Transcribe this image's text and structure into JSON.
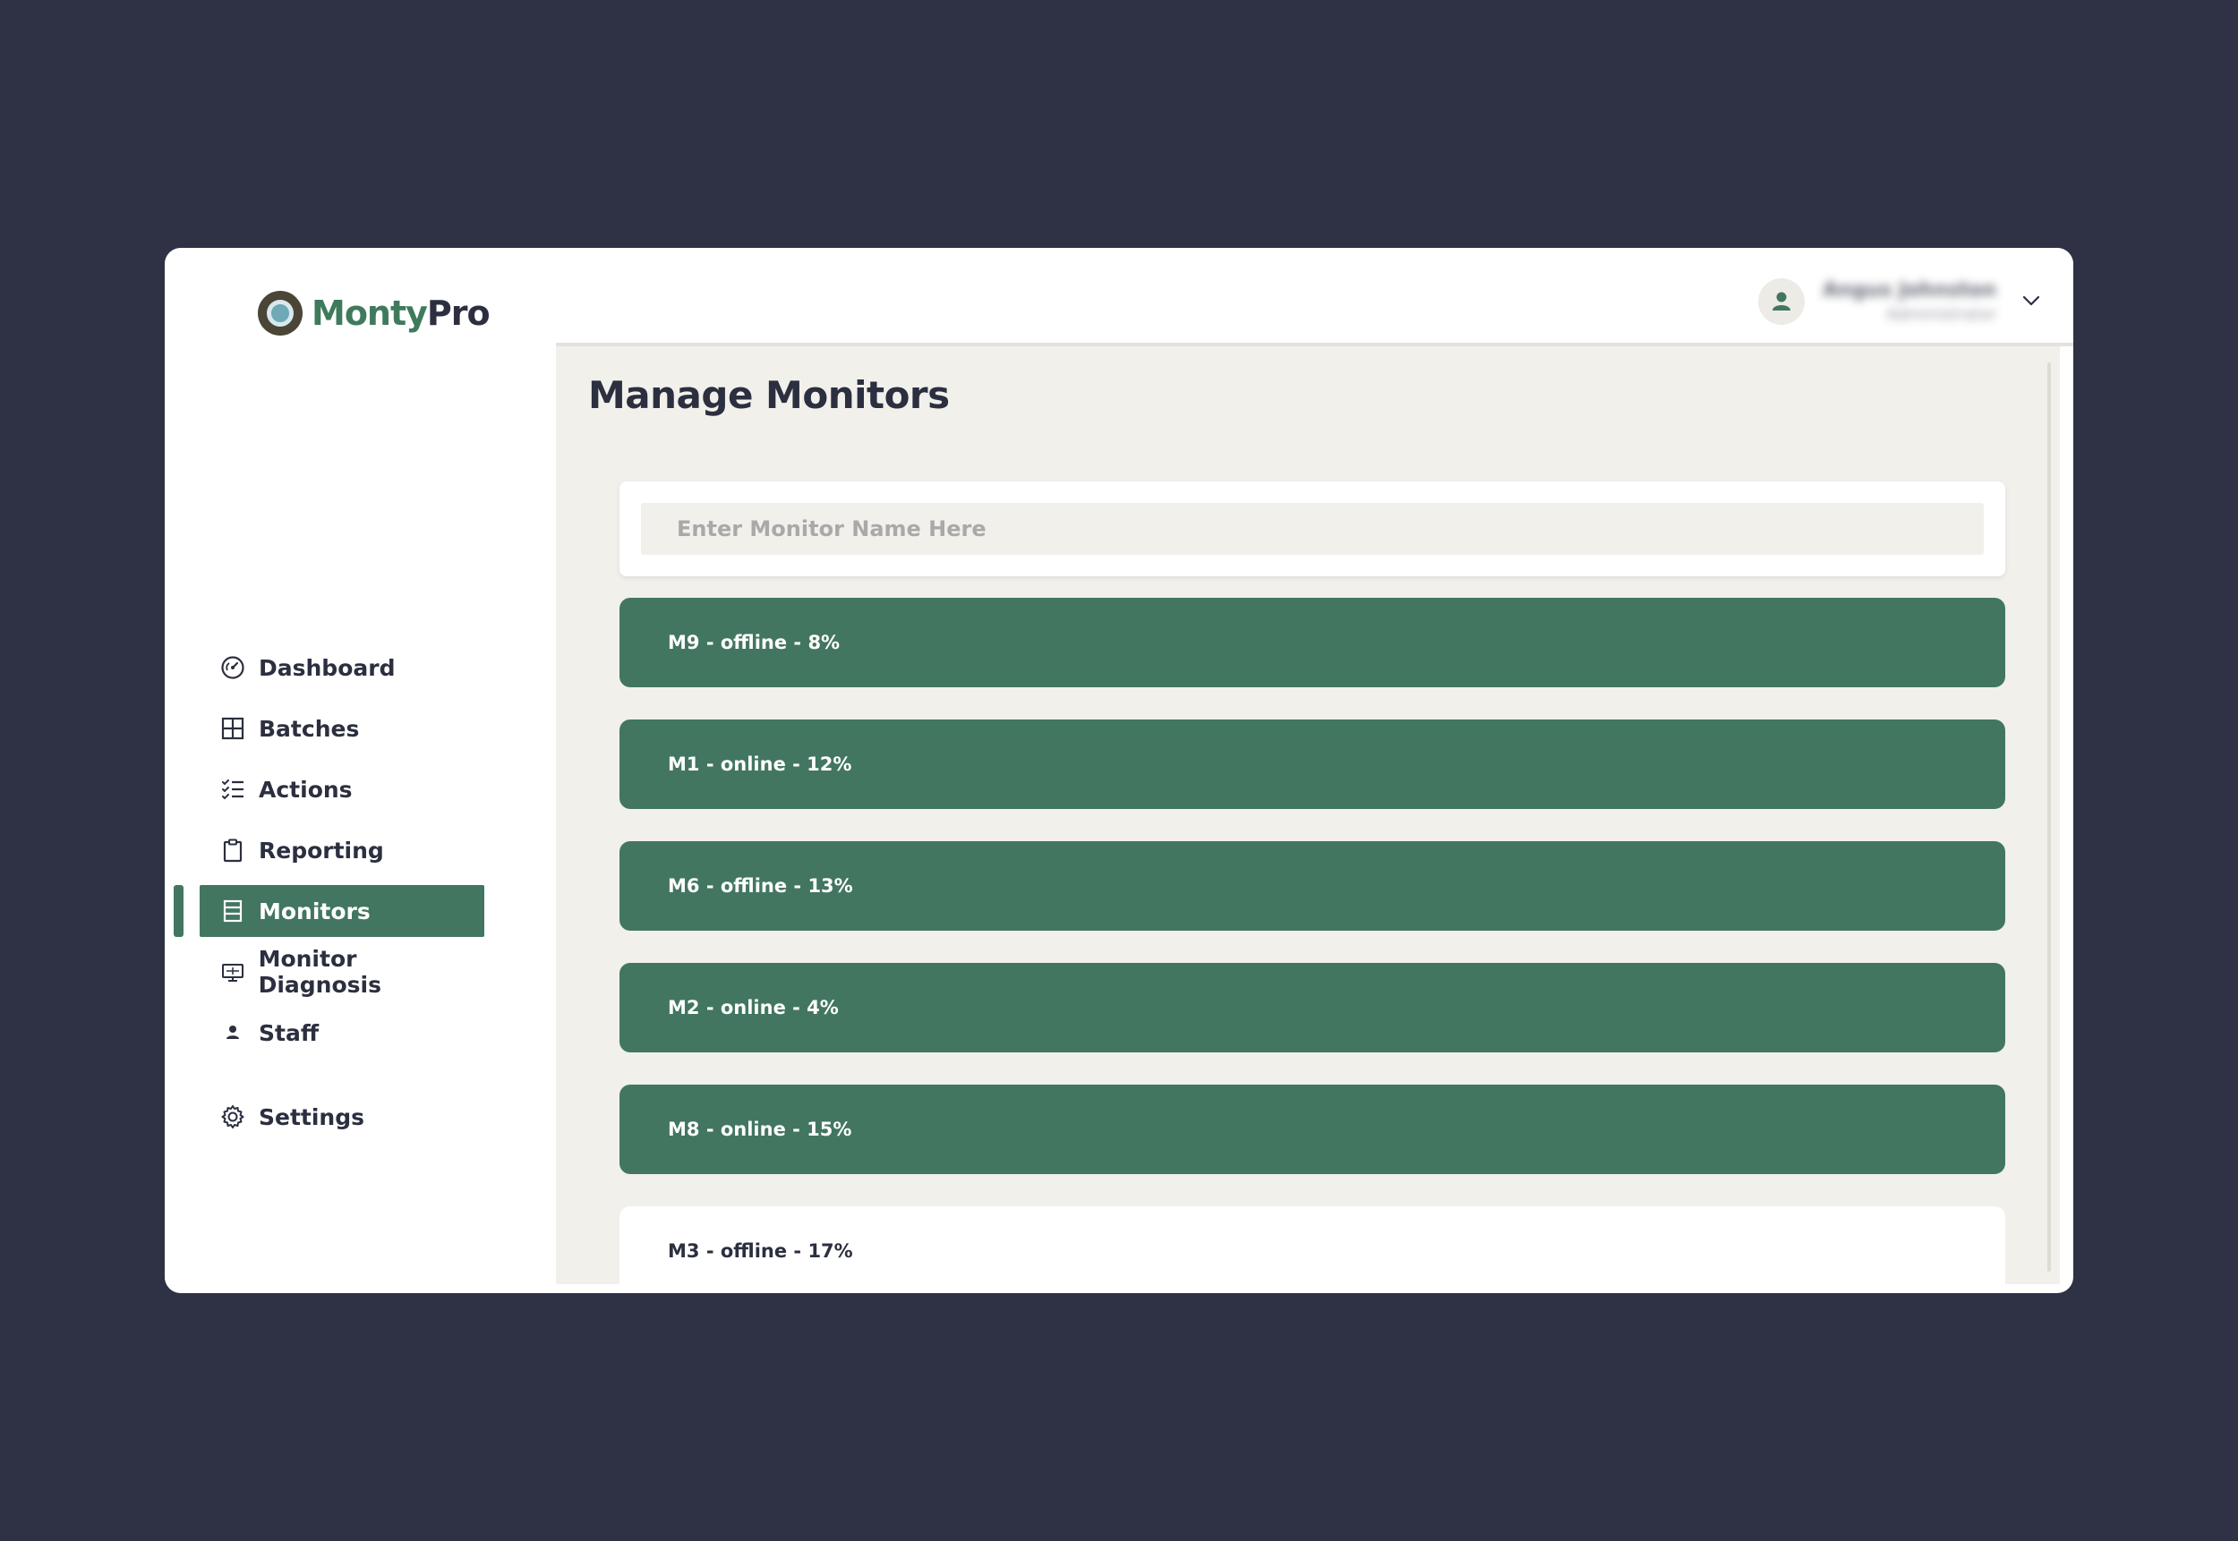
{
  "brand": {
    "part1": "Monty",
    "part2": "Pro"
  },
  "sidebar": {
    "items": [
      {
        "label": "Dashboard",
        "icon": "dashboard-gauge-icon"
      },
      {
        "label": "Batches",
        "icon": "grid-icon"
      },
      {
        "label": "Actions",
        "icon": "checklist-icon"
      },
      {
        "label": "Reporting",
        "icon": "clipboard-icon"
      },
      {
        "label": "Monitors",
        "icon": "list-panel-icon",
        "active": true
      },
      {
        "label": "Monitor Diagnosis",
        "icon": "monitor-icon"
      },
      {
        "label": "Staff",
        "icon": "person-icon"
      },
      {
        "label": "Settings",
        "icon": "gear-icon"
      }
    ]
  },
  "header": {
    "user_name": "Angus Johnston",
    "user_role": "Administrator"
  },
  "main": {
    "title": "Manage Monitors",
    "search_placeholder": "Enter Monitor Name Here",
    "monitors": [
      {
        "label": "M9 - offline - 8%",
        "style": "green"
      },
      {
        "label": "M1 - online - 12%",
        "style": "green"
      },
      {
        "label": "M6 - offline - 13%",
        "style": "green"
      },
      {
        "label": "M2 - online - 4%",
        "style": "green"
      },
      {
        "label": "M8 - online - 15%",
        "style": "green"
      },
      {
        "label": "M3 - offline - 17%",
        "style": "white"
      }
    ]
  },
  "colors": {
    "background": "#2f3244",
    "accent": "#427660",
    "main_bg": "#f1f0eb",
    "text": "#2b2f3f"
  }
}
